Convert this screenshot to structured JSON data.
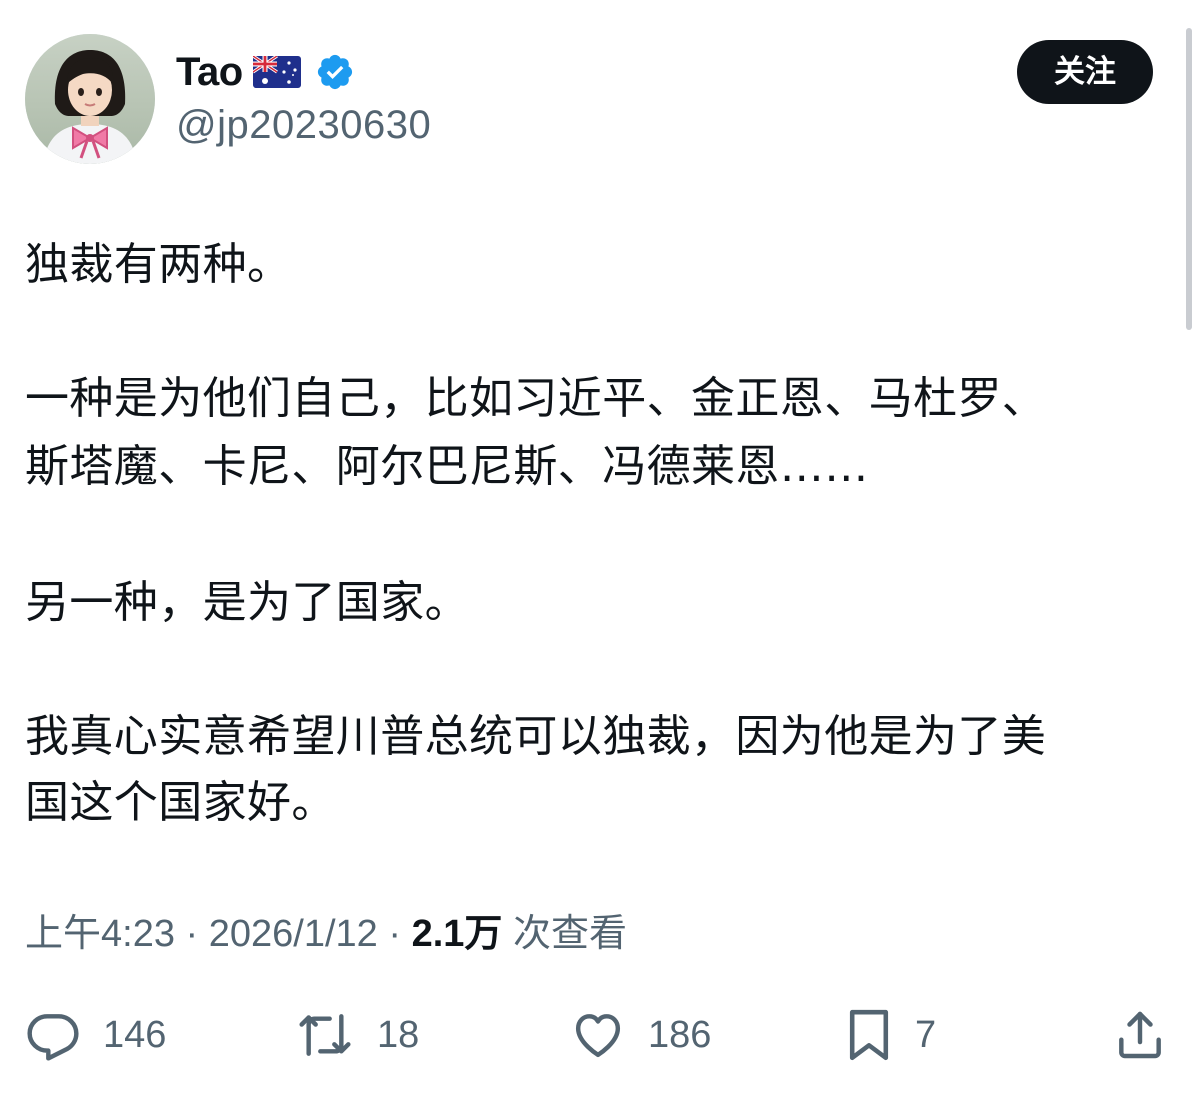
{
  "profile": {
    "display_name": "Tao",
    "flag_icon": "australia-flag-icon",
    "verified_icon": "verified-badge-icon",
    "verified_color": "#1d9bf0",
    "handle": "@jp20230630",
    "follow_label": "关注"
  },
  "tweet": {
    "lines": [
      "独裁有两种。",
      "一种是为他们自己，比如习近平、金正恩、马杜罗、",
      "斯塔魔、卡尼、阿尔巴尼斯、冯德莱恩……",
      "另一种，是为了国家。",
      "我真心实意希望川普总统可以独裁，因为他是为了美",
      "国这个国家好。"
    ]
  },
  "meta": {
    "time": "上午4:23",
    "separator": "·",
    "date": "2026/1/12",
    "views_count": "2.1万",
    "views_label": "次查看"
  },
  "actions": {
    "reply_count": "146",
    "repost_count": "18",
    "like_count": "186",
    "bookmark_count": "7"
  },
  "colors": {
    "text_primary": "#0f1419",
    "text_secondary": "#536471",
    "button_bg": "#0f1419"
  }
}
